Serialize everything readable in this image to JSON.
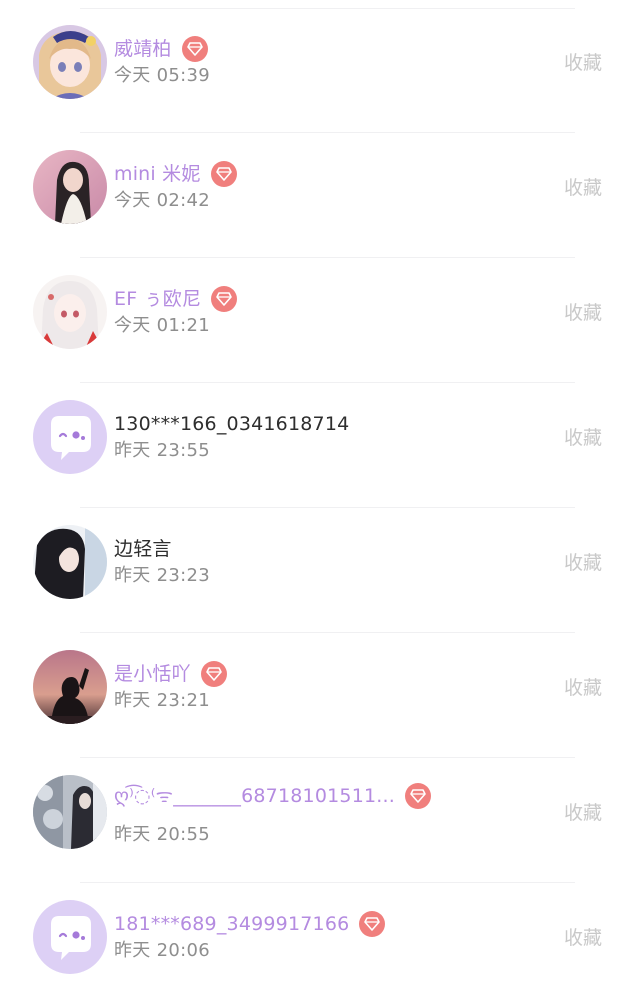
{
  "colors": {
    "vip_name": "#b48be0",
    "normal_name": "#2e2e2e",
    "time": "#8e8e8e",
    "favorite": "#c9c9c9",
    "badge": "#f07f7d",
    "divider": "#f0f0f2"
  },
  "favorite_label": "收藏",
  "users": [
    {
      "name": "威靖柏",
      "time": "今天 05:39",
      "vip": true,
      "avatar": "anime-girl-blonde"
    },
    {
      "name": "mini 米妮",
      "time": "今天 02:42",
      "vip": true,
      "avatar": "photo-girl-pink"
    },
    {
      "name": "EF ぅ欧尼",
      "time": "今天 01:21",
      "vip": true,
      "avatar": "anime-girl-white"
    },
    {
      "name": "130***166_0341618714",
      "time": "昨天 23:55",
      "vip": false,
      "avatar": "default-chat-bubble"
    },
    {
      "name": "边轻言",
      "time": "昨天 23:23",
      "vip": false,
      "avatar": "photo-girl-dark-hair"
    },
    {
      "name": "是小恬吖",
      "time": "昨天 23:21",
      "vip": true,
      "avatar": "silhouette-sunset"
    },
    {
      "name": "ღ⁾͡◌⁽ᯤ_______68718101511...",
      "time": "昨天 20:55",
      "vip": true,
      "avatar": "photo-grey-blur"
    },
    {
      "name": "181***689_3499917166",
      "time": "昨天 20:06",
      "vip": true,
      "avatar": "default-chat-bubble"
    }
  ]
}
